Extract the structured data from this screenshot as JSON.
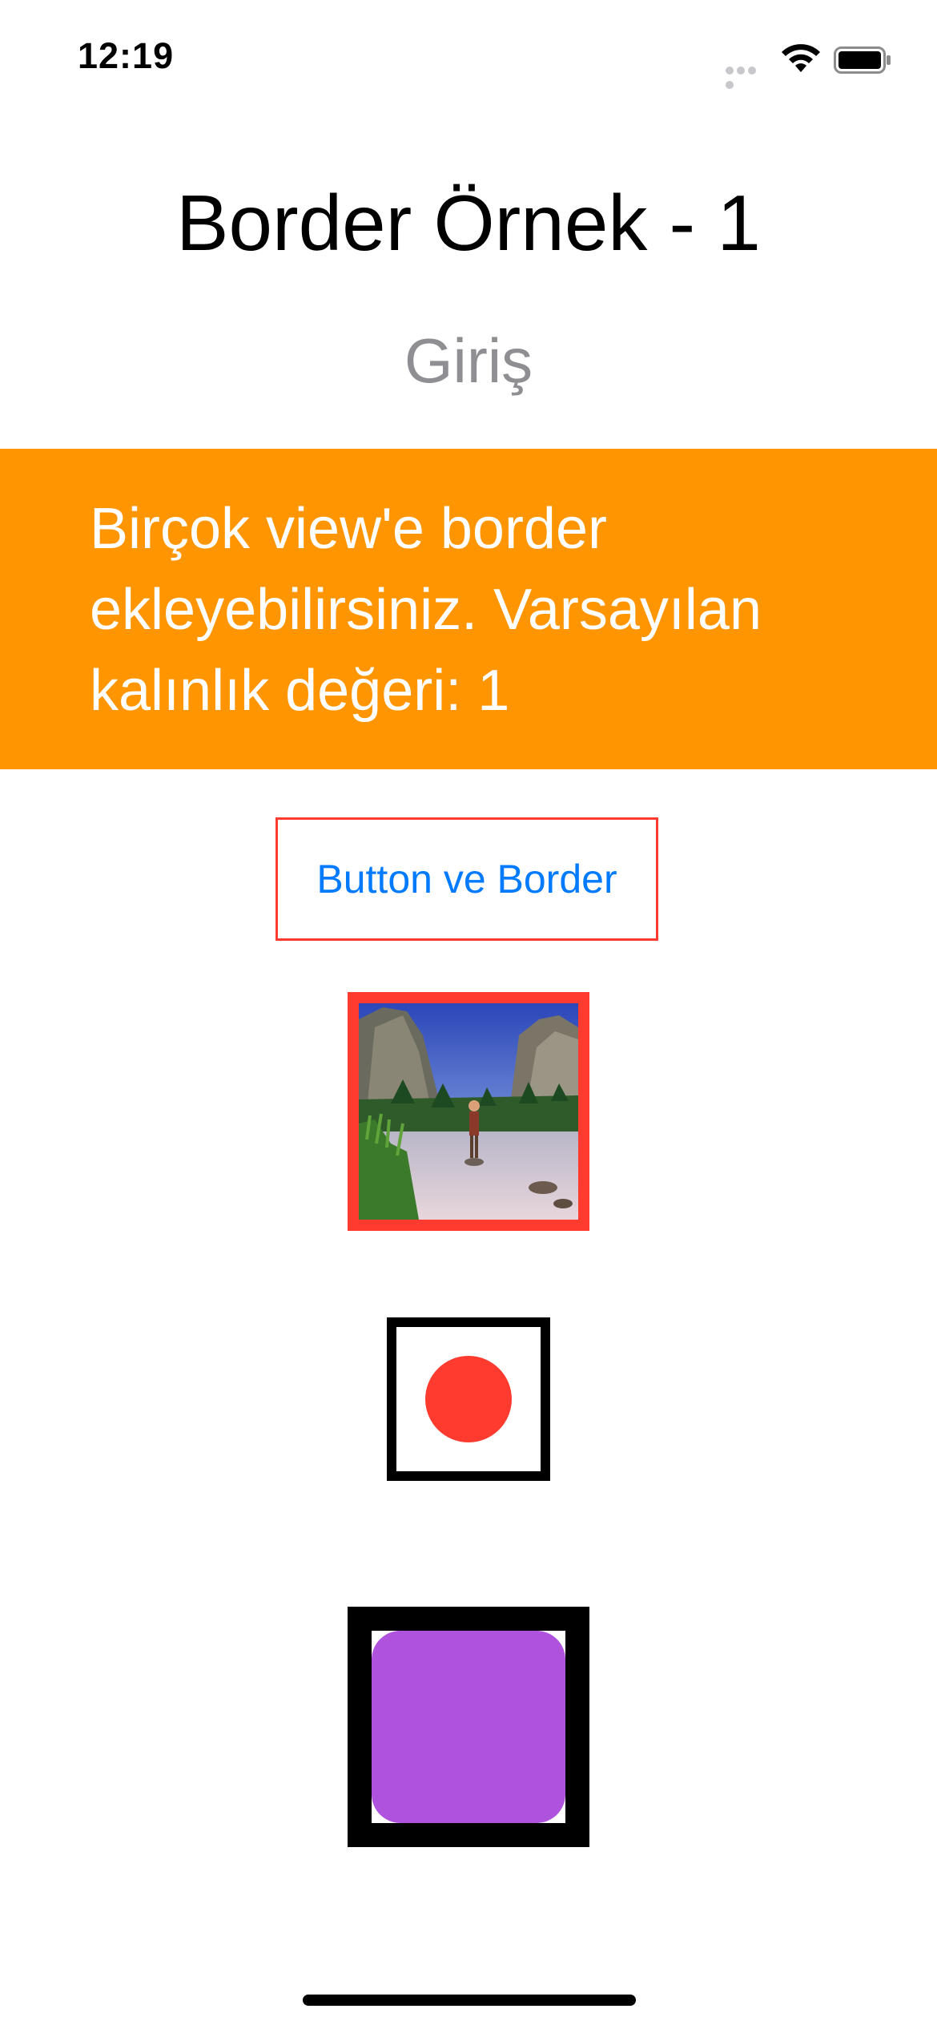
{
  "status_bar": {
    "time": "12:19",
    "signal_icon": "signal-dots-icon",
    "wifi_icon": "wifi-icon",
    "battery_icon": "battery-icon"
  },
  "page": {
    "title": "Border Örnek - 1",
    "subtitle": "Giriş"
  },
  "banner": {
    "text": "Birçok view'e border ekleyebilirsiniz. Varsayılan kalınlık değeri: 1",
    "background_color": "#ff9500"
  },
  "button": {
    "label": "Button ve Border",
    "border_color": "#ff3b30",
    "text_color": "#007aff"
  },
  "image_view": {
    "border_color": "#ff3b30",
    "icon": "landscape-photo-icon"
  },
  "dot_view": {
    "border_color": "#000000",
    "dot_color": "#ff3b30"
  },
  "purple_view": {
    "border_color": "#000000",
    "fill_color": "#af52de"
  }
}
